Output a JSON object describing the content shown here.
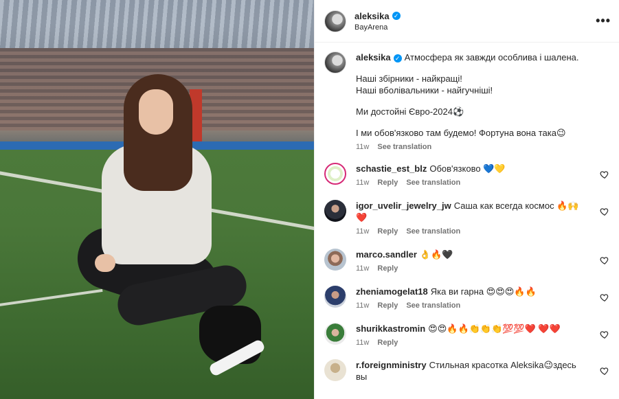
{
  "post": {
    "owner": "aleksika",
    "location": "BayArena",
    "more_icon": "more-horizontal-icon"
  },
  "caption": {
    "username": "aleksika",
    "lines": [
      "Атмосфера як завжди особлива і шалена.",
      "Наші збірники - найкращі!",
      "Наші вболівальники - найгучніші!",
      "Ми достойні Євро-2024⚽",
      "І ми обов'язково там будемо! Фортуна вона така😉"
    ],
    "time": "11w",
    "see_translation": "See translation"
  },
  "comments": [
    {
      "username": "schastie_est_blz",
      "text": "Обов'язково 💙💛",
      "time": "11w",
      "reply": "Reply",
      "see_translation": "See translation"
    },
    {
      "username": "igor_uvelir_jewelry_jw",
      "text": "Саша как всегда космос 🔥🙌❤️",
      "time": "11w",
      "reply": "Reply",
      "see_translation": "See translation"
    },
    {
      "username": "marco.sandler",
      "text": "👌🔥🖤",
      "time": "11w",
      "reply": "Reply"
    },
    {
      "username": "zheniamogelat18",
      "text": "Яка ви гарна 😍😍😍🔥🔥",
      "time": "11w",
      "reply": "Reply",
      "see_translation": "See translation"
    },
    {
      "username": "shurikkastromin",
      "text": "😍😍🔥🔥👏👏👏💯💯❤️ ❤️❤️",
      "time": "11w",
      "reply": "Reply"
    },
    {
      "username": "r.foreignministry",
      "text": "Стильная красотка Aleksika😉здесь вы"
    }
  ],
  "colors": {
    "accent": "#0095f6",
    "muted": "#737373",
    "text": "#262626"
  }
}
